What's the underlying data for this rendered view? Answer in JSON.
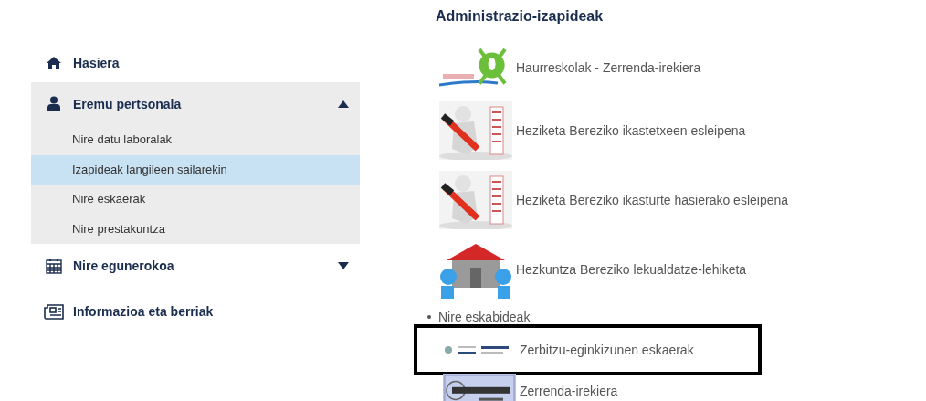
{
  "sidebar": {
    "items": [
      {
        "label": "Hasiera",
        "kind": "link"
      },
      {
        "label": "Eremu pertsonala",
        "kind": "group",
        "expanded": true,
        "children": [
          {
            "label": "Nire datu laboralak",
            "selected": false
          },
          {
            "label": "Izapideak langileen sailarekin",
            "selected": true
          },
          {
            "label": "Nire eskaerak",
            "selected": false
          },
          {
            "label": "Nire prestakuntza",
            "selected": false
          }
        ]
      },
      {
        "label": "Nire egunerokoa",
        "kind": "group",
        "expanded": false
      },
      {
        "label": "Informazioa eta berriak",
        "kind": "link"
      }
    ]
  },
  "main": {
    "title": "Administrazio-izapideak",
    "links": [
      {
        "label": "Haurreskolak - Zerrenda-irekiera",
        "kind": "picture"
      },
      {
        "label": "Heziketa Bereziko ikastetxeen esleipena",
        "kind": "picture"
      },
      {
        "label": "Heziketa Bereziko ikasturte hasierako esleipena",
        "kind": "picture"
      },
      {
        "label": "Hezkuntza Bereziko lekualdatze-lehiketa",
        "kind": "picture"
      }
    ],
    "section": {
      "label": "Nire eskabideak",
      "links": [
        {
          "label": "Zerbitzu-eginkizunen eskaerak",
          "kind": "picture",
          "highlighted": true
        },
        {
          "label": "Zerrenda-irekiera",
          "kind": "picture",
          "highlighted": false
        }
      ]
    }
  }
}
